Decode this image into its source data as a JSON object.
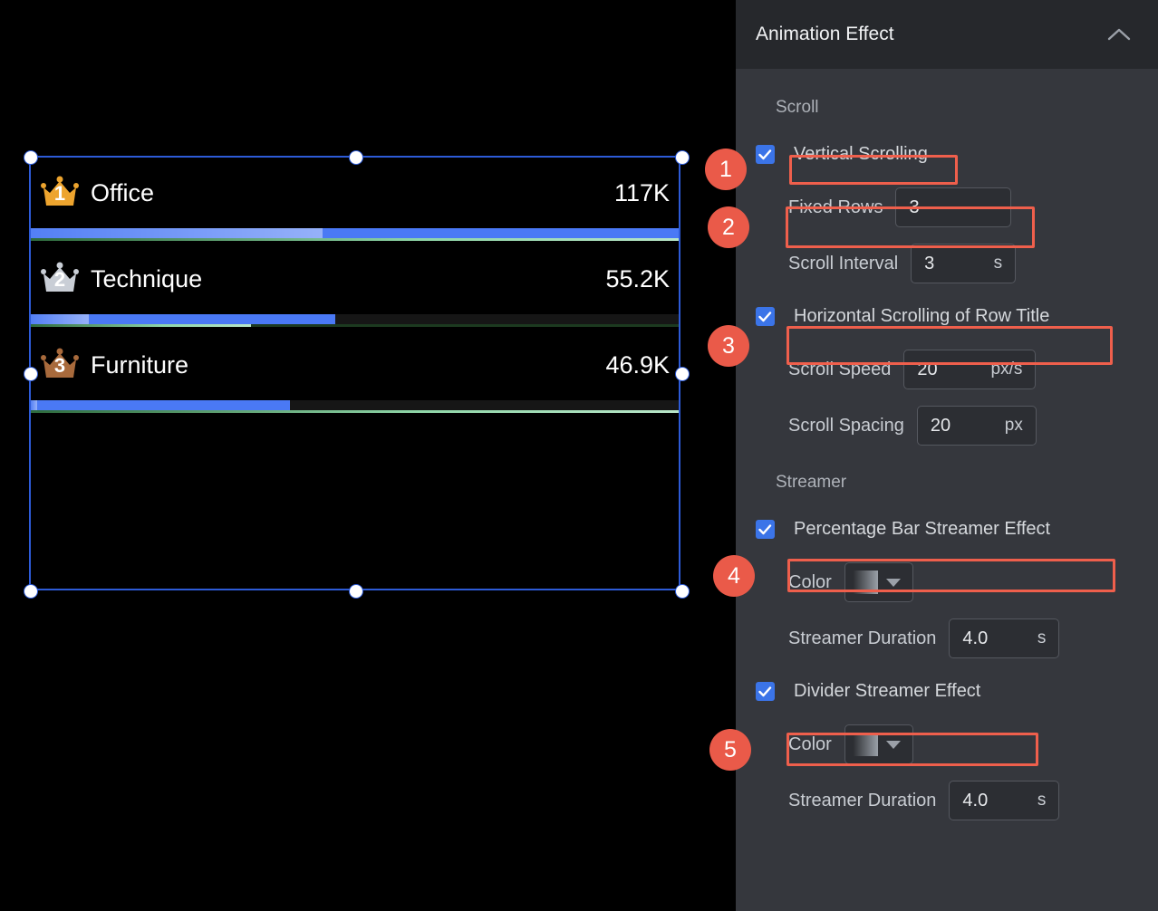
{
  "canvas": {
    "name": "ranking-bar-widget",
    "rows": [
      {
        "rank": "1",
        "title": "Office",
        "value": "117K",
        "crown_color": "#eda42e",
        "fill_pct": 100,
        "streamer_left_pct": 0,
        "streamer_width_pct": 45,
        "divider_streamer_pct": 100
      },
      {
        "rank": "2",
        "title": "Technique",
        "value": "55.2K",
        "crown_color": "#c9ced6",
        "fill_pct": 47,
        "streamer_left_pct": 0,
        "streamer_width_pct": 9,
        "divider_streamer_pct": 34
      },
      {
        "rank": "3",
        "title": "Furniture",
        "value": "46.9K",
        "crown_color": "#a86a3c",
        "fill_pct": 40,
        "streamer_left_pct": 0,
        "streamer_width_pct": 1,
        "divider_streamer_pct": 100
      }
    ]
  },
  "panel": {
    "title": "Animation Effect",
    "collapse_icon": "chevron-up-icon",
    "sections": {
      "scroll_label": "Scroll",
      "streamer_label": "Streamer"
    },
    "vertical_scrolling": {
      "label": "Vertical Scrolling",
      "checked": true
    },
    "fixed_rows": {
      "label": "Fixed Rows",
      "value": "3"
    },
    "scroll_interval": {
      "label": "Scroll Interval",
      "value": "3",
      "unit": "s"
    },
    "horizontal_scrolling": {
      "label": "Horizontal Scrolling of Row Title",
      "checked": true
    },
    "scroll_speed": {
      "label": "Scroll Speed",
      "value": "20",
      "unit": "px/s"
    },
    "scroll_spacing": {
      "label": "Scroll Spacing",
      "value": "20",
      "unit": "px"
    },
    "percentage_bar_streamer": {
      "label": "Percentage Bar Streamer Effect",
      "checked": true
    },
    "percentage_bar_color": {
      "label": "Color",
      "icon": "caret-down-icon"
    },
    "percentage_bar_duration": {
      "label": "Streamer Duration",
      "value": "4.0",
      "unit": "s"
    },
    "divider_streamer": {
      "label": "Divider Streamer Effect",
      "checked": true
    },
    "divider_color": {
      "label": "Color",
      "icon": "caret-down-icon"
    },
    "divider_duration": {
      "label": "Streamer Duration",
      "value": "4.0",
      "unit": "s"
    }
  },
  "annotations": {
    "accent_color": "#ea5a49",
    "badges": [
      {
        "number": "1"
      },
      {
        "number": "2"
      },
      {
        "number": "3"
      },
      {
        "number": "4"
      },
      {
        "number": "5"
      }
    ]
  }
}
